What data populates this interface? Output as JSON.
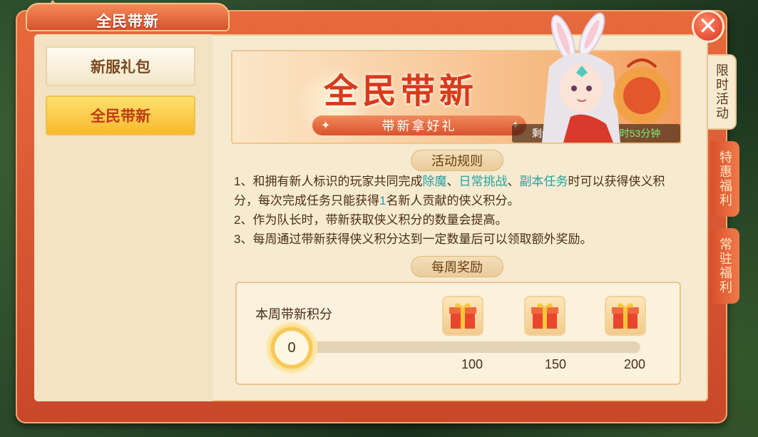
{
  "window": {
    "title": "全民带新"
  },
  "sidebar": {
    "items": [
      {
        "label": "新服礼包"
      },
      {
        "label": "全民带新"
      }
    ]
  },
  "right_tabs": [
    {
      "label": "限时活动"
    },
    {
      "label": "特惠福利"
    },
    {
      "label": "常驻福利"
    }
  ],
  "banner": {
    "title": "全民带新",
    "subtitle": "带新拿好礼",
    "remaining_label": "剩余时间:",
    "remaining_value": "28天04小时53分钟"
  },
  "rules": {
    "header": "活动规则",
    "line1_a": "1、和拥有新人标识的玩家共同完成",
    "line1_hl1": "除魔",
    "line1_sep1": "、",
    "line1_hl2": "日常挑战",
    "line1_sep2": "、",
    "line1_hl3": "副本任务",
    "line1_b": "时可以获得侠义积分，每次完成任务只能获得",
    "line1_hl4": "1",
    "line1_c": "名新人贡献的侠义积分。",
    "line2": "2、作为队长时，带新获取侠义积分的数量会提高。",
    "line3": "3、每周通过带新获得侠义积分达到一定数量后可以领取额外奖励。"
  },
  "weekly": {
    "header": "每周奖励",
    "score_label": "本周带新积分",
    "score_value": "0",
    "progress_fraction": 0,
    "milestones": [
      {
        "label": "100"
      },
      {
        "label": "150"
      },
      {
        "label": "200"
      }
    ]
  },
  "close_icon": "close-icon",
  "colors": {
    "accent": "#d9502c",
    "highlight": "#2aa0a0",
    "timer": "#7cf07c"
  }
}
